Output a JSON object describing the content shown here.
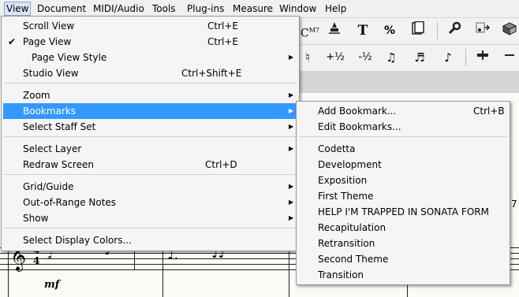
{
  "menubar": {
    "items": [
      {
        "label": "View"
      },
      {
        "label": "Document"
      },
      {
        "label": "MIDI/Audio"
      },
      {
        "label": "Tools"
      },
      {
        "label": "Plug-ins"
      },
      {
        "label": "Measure"
      },
      {
        "label": "Window"
      },
      {
        "label": "Help"
      }
    ]
  },
  "toolbar": {
    "chord_label": "C",
    "chord_superscript": "M7",
    "text_tool": "T",
    "percent_tool": "%",
    "plus_half": "+½",
    "minus_half": "-½"
  },
  "view_menu": {
    "items": [
      {
        "label": "Scroll View",
        "shortcut": "Ctrl+E"
      },
      {
        "label": "Page View",
        "shortcut": "Ctrl+E",
        "checked": true
      },
      {
        "label": "Page View Style"
      },
      {
        "label": "Studio View",
        "shortcut": "Ctrl+Shift+E"
      },
      {
        "label": "Zoom"
      },
      {
        "label": "Bookmarks",
        "highlighted": true
      },
      {
        "label": "Select Staff Set"
      },
      {
        "label": "Select Layer"
      },
      {
        "label": "Redraw Screen",
        "shortcut": "Ctrl+D"
      },
      {
        "label": "Grid/Guide"
      },
      {
        "label": "Out-of-Range Notes"
      },
      {
        "label": "Show"
      },
      {
        "label": "Select Display Colors..."
      }
    ]
  },
  "bookmarks_menu": {
    "items": [
      {
        "label": "Add Bookmark...",
        "shortcut": "Ctrl+B"
      },
      {
        "label": "Edit Bookmarks..."
      },
      {
        "label": "Codetta"
      },
      {
        "label": "Development"
      },
      {
        "label": "Exposition"
      },
      {
        "label": "First Theme"
      },
      {
        "label": "HELP I'M TRAPPED IN SONATA FORM"
      },
      {
        "label": "Recapitulation"
      },
      {
        "label": "Retransition"
      },
      {
        "label": "Second Theme"
      },
      {
        "label": "Transition"
      }
    ]
  },
  "score": {
    "time_signature_top": "4",
    "time_signature_bottom": "4",
    "dynamic": "mf",
    "edge_digit": "7"
  },
  "colors": {
    "highlight": "#3399ff",
    "menu_bg": "#f5f5f5",
    "paper": "#fbfaf4"
  }
}
